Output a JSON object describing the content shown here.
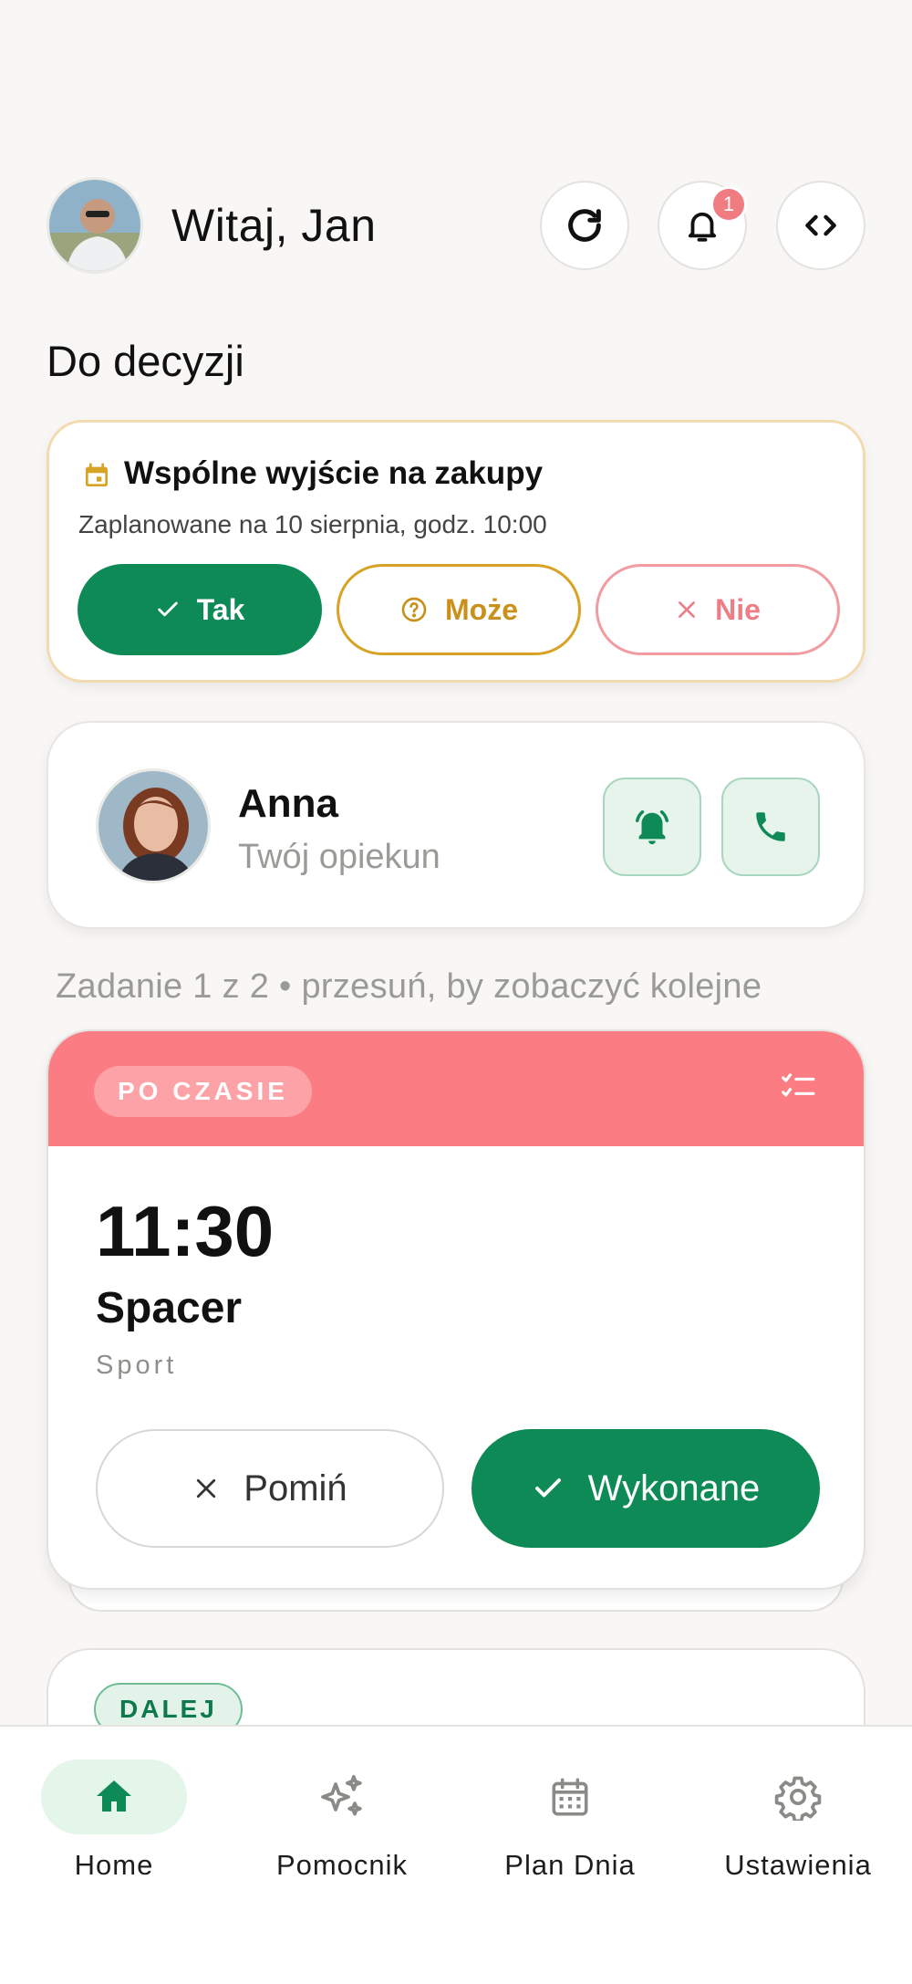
{
  "header": {
    "greeting": "Witaj, Jan",
    "notification_count": "1"
  },
  "section_title": "Do decyzji",
  "decision": {
    "title": "Wspólne wyjście na zakupy",
    "subtitle": "Zaplanowane na 10 sierpnia, godz. 10:00",
    "yes_label": "Tak",
    "maybe_label": "Może",
    "no_label": "Nie"
  },
  "caregiver": {
    "name": "Anna",
    "role": "Twój opiekun"
  },
  "task_hint": "Zadanie 1 z 2 • przesuń, by zobaczyć kolejne",
  "task": {
    "status": "PO CZASIE",
    "time": "11:30",
    "name": "Spacer",
    "category": "Sport",
    "skip_label": "Pomiń",
    "done_label": "Wykonane"
  },
  "next_task": {
    "status": "DALEJ"
  },
  "nav": {
    "items": [
      {
        "label": "Home",
        "icon": "home-icon"
      },
      {
        "label": "Pomocnik",
        "icon": "sparkles-icon"
      },
      {
        "label": "Plan Dnia",
        "icon": "calendar-icon"
      },
      {
        "label": "Ustawienia",
        "icon": "gear-icon"
      }
    ]
  },
  "colors": {
    "accent_green": "#0e8a56",
    "overdue_red": "#fc7c83",
    "maybe_gold": "#d7a325",
    "no_pink": "#ee7d85"
  }
}
